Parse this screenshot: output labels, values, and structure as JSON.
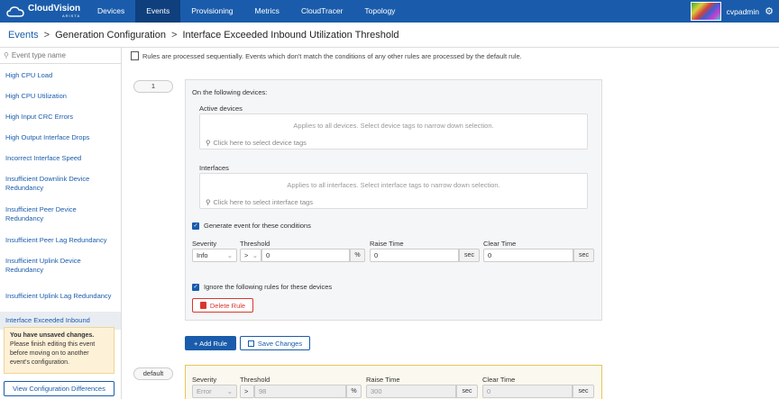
{
  "nav": {
    "brand_name": "CloudVision",
    "brand_sub": "ARISTA",
    "items": [
      "Devices",
      "Events",
      "Provisioning",
      "Metrics",
      "CloudTracer",
      "Topology"
    ],
    "active": "Events",
    "username": "cvpadmin"
  },
  "breadcrumb": {
    "root": "Events",
    "middle": "Generation Configuration",
    "current": "Interface Exceeded Inbound Utilization Threshold"
  },
  "sidebar": {
    "search_placeholder": "Event type name",
    "items": [
      "High CPU Load",
      "High CPU Utilization",
      "High Input CRC Errors",
      "High Output Interface Drops",
      "Incorrect Interface Speed",
      "Insufficient Downlink Device Redundancy",
      "Insufficient Peer Device Redundancy",
      "Insufficient Peer Lag Redundancy",
      "Insufficient Uplink Device Redundancy",
      "Insufficient Uplink Lag Redundancy",
      "Interface Exceeded Inbound"
    ],
    "warning_title": "You have unsaved changes.",
    "warning_body": "Please finish editing this event before moving on to another event's configuration.",
    "view_diff_label": "View Configuration Differences"
  },
  "main": {
    "info_text": "Rules are processed sequentially. Events which don't match the conditions of any other rules are processed by the default rule.",
    "rule1": {
      "number": "1",
      "devices_heading": "On the following devices:",
      "active_devices_label": "Active devices",
      "devices_hint": "Applies to all devices. Select device tags to narrow down selection.",
      "devices_select": "Click here to select device tags",
      "interfaces_label": "Interfaces",
      "interfaces_hint": "Applies to all interfaces. Select interface tags to narrow down selection.",
      "interfaces_select": "Click here to select interface tags",
      "generate_label": "Generate event for these conditions",
      "severity_label": "Severity",
      "threshold_label": "Threshold",
      "raise_label": "Raise Time",
      "clear_label": "Clear Time",
      "severity_value": "Info",
      "operator_value": ">",
      "threshold_value": "0",
      "threshold_unit": "%",
      "raise_value": "0",
      "raise_unit": "sec",
      "clear_value": "0",
      "clear_unit": "sec",
      "ignore_label": "Ignore the following rules for these devices",
      "delete_label": "Delete Rule"
    },
    "add_rule_label": "+ Add Rule",
    "save_label": "Save Changes",
    "default_rule": {
      "label": "default",
      "severity_label": "Severity",
      "threshold_label": "Threshold",
      "raise_label": "Raise Time",
      "clear_label": "Clear Time",
      "severity_value": "Error",
      "operator_value": ">",
      "threshold_value": "98",
      "threshold_unit": "%",
      "raise_value": "300",
      "raise_unit": "sec",
      "clear_value": "0",
      "clear_unit": "sec"
    }
  },
  "colors": {
    "nav_bg": "#1a5cab",
    "accent": "#1a5cab",
    "danger": "#d9372c",
    "warning_bg": "#fdf1d7"
  }
}
